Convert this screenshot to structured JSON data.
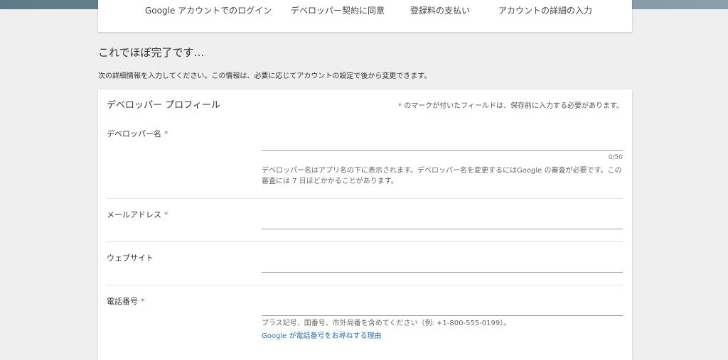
{
  "steps": [
    {
      "label": "Google アカウントでのログイン"
    },
    {
      "label": "デベロッパー契約に同意"
    },
    {
      "label": "登録料の支払い"
    },
    {
      "label": "アカウントの詳細の入力"
    }
  ],
  "page": {
    "title": "これでほぼ完了です…",
    "description": "次の詳細情報を入力してください。この情報は、必要に応じてアカウントの設定で後から変更できます。"
  },
  "profile": {
    "title": "デベロッパー プロフィール",
    "required_star": "*",
    "required_note": "のマークが付いたフィールドは、保存前に入力する必要があります。",
    "developer_name": {
      "label": "デベロッパー名",
      "value": "",
      "counter": "0/50",
      "help": "デベロッパー名はアプリ名の下に表示されます。デベロッパー名を変更するにはGoogle の審査が必要です。この審査には 7 日ほどかかることがあります。"
    },
    "email": {
      "label": "メールアドレス",
      "value": ""
    },
    "website": {
      "label": "ウェブサイト",
      "value": ""
    },
    "phone": {
      "label": "電話番号",
      "value": "",
      "help": "プラス記号、国番号、市外局番を含めてください（例: +1-800-555-0199）。",
      "link": "Google が電話番号をお尋ねする理由"
    }
  },
  "colors": {
    "accent": "#3f86c8",
    "link": "#2a6fb0",
    "background": "#efefef",
    "card": "#ffffff"
  }
}
